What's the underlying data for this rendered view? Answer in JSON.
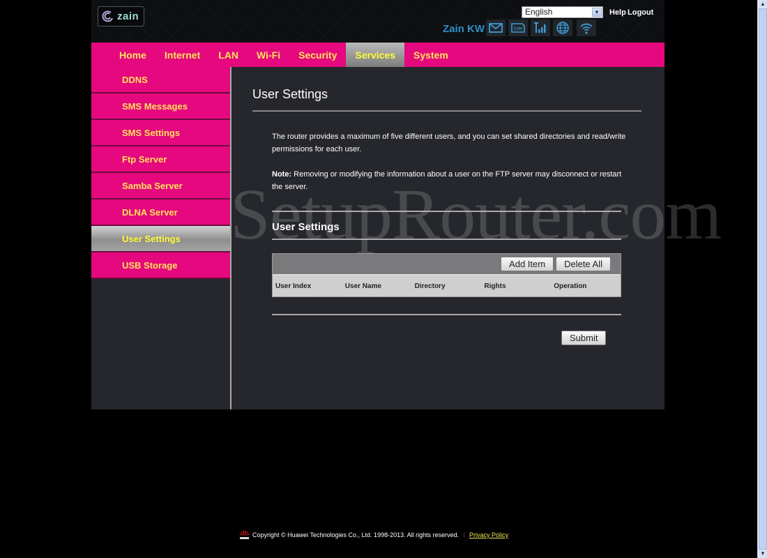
{
  "header": {
    "logo_text": "zain",
    "language": "English",
    "help": "Help",
    "logout": "Logout",
    "operator": "Zain KW",
    "status_icons": [
      "mail-icon",
      "sim-icon",
      "signal-icon",
      "globe-icon",
      "wifi-icon"
    ]
  },
  "nav": {
    "items": [
      {
        "label": "Home",
        "active": false
      },
      {
        "label": "Internet",
        "active": false
      },
      {
        "label": "LAN",
        "active": false
      },
      {
        "label": "Wi-Fi",
        "active": false
      },
      {
        "label": "Security",
        "active": false
      },
      {
        "label": "Services",
        "active": true
      },
      {
        "label": "System",
        "active": false
      }
    ]
  },
  "sidebar": {
    "items": [
      {
        "label": "DDNS",
        "active": false
      },
      {
        "label": "SMS Messages",
        "active": false
      },
      {
        "label": "SMS Settings",
        "active": false
      },
      {
        "label": "Ftp Server",
        "active": false
      },
      {
        "label": "Samba Server",
        "active": false
      },
      {
        "label": "DLNA Server",
        "active": false
      },
      {
        "label": "User Settings",
        "active": true
      },
      {
        "label": "USB Storage",
        "active": false
      }
    ]
  },
  "main": {
    "title": "User Settings",
    "description": "The router provides a maximum of five different users, and you can set shared directories and read/write permissions for each user.",
    "note_label": "Note:",
    "note_text": " Removing or modifying the information about a user on the FTP server may disconnect or restart the server.",
    "section_title": "User Settings",
    "add_item": "Add Item",
    "delete_all": "Delete All",
    "columns": [
      "User Index",
      "User Name",
      "Directory",
      "Rights",
      "Operation"
    ],
    "rows": [],
    "submit": "Submit"
  },
  "watermark": "SetupRouter.com",
  "footer": {
    "copyright": "Copyright © Huawei Technologies Co., Ltd. 1998-2013. All rights reserved.",
    "separator": "⁝",
    "privacy": "Privacy Policy"
  },
  "colors": {
    "brand_pink": "#e5087e",
    "nav_text": "#ffe35a",
    "operator_blue": "#2f8fc9"
  }
}
